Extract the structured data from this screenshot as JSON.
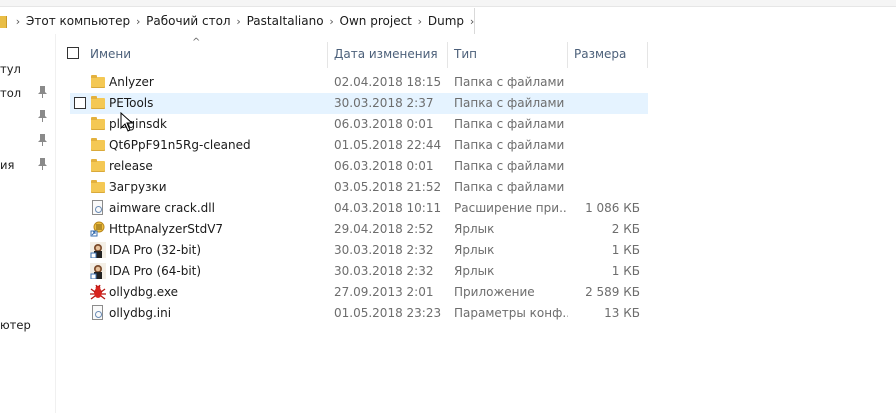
{
  "breadcrumb": {
    "items": [
      "Этот компьютер",
      "Рабочий стол",
      "PastaItaliano",
      "Own project",
      "Dump"
    ]
  },
  "nav": {
    "labels": [
      "тул",
      "тол",
      "ия",
      "ютер"
    ]
  },
  "columns": {
    "name": "Имени",
    "date": "Дата изменения",
    "type": "Тип",
    "size": "Размера"
  },
  "files": [
    {
      "name": "Anlyzer",
      "date": "02.04.2018 18:15",
      "type": "Папка с файлами",
      "size": "",
      "icon": "folder-icon"
    },
    {
      "name": "PETools",
      "date": "30.03.2018 2:37",
      "type": "Папка с файлами",
      "size": "",
      "icon": "folder-icon"
    },
    {
      "name": "pluginsdk",
      "date": "06.03.2018 0:01",
      "type": "Папка с файлами",
      "size": "",
      "icon": "folder-icon"
    },
    {
      "name": "Qt6PpF91n5Rg-cleaned",
      "date": "01.05.2018 22:44",
      "type": "Папка с файлами",
      "size": "",
      "icon": "folder-icon"
    },
    {
      "name": "release",
      "date": "06.03.2018 0:01",
      "type": "Папка с файлами",
      "size": "",
      "icon": "folder-icon"
    },
    {
      "name": "Загрузки",
      "date": "03.05.2018 21:52",
      "type": "Папка с файлами",
      "size": "",
      "icon": "folder-icon"
    },
    {
      "name": "aimware crack.dll",
      "date": "04.03.2018 10:11",
      "type": "Расширение при...",
      "size": "1 086 КБ",
      "icon": "dll-file-icon"
    },
    {
      "name": "HttpAnalyzerStdV7",
      "date": "29.04.2018 2:52",
      "type": "Ярлык",
      "size": "2 КБ",
      "icon": "http-analyzer-shortcut-icon"
    },
    {
      "name": "IDA Pro (32-bit)",
      "date": "30.03.2018 2:32",
      "type": "Ярлык",
      "size": "1 КБ",
      "icon": "ida-pro-icon"
    },
    {
      "name": "IDA Pro (64-bit)",
      "date": "30.03.2018 2:32",
      "type": "Ярлык",
      "size": "1 КБ",
      "icon": "ida-pro-icon"
    },
    {
      "name": "ollydbg.exe",
      "date": "27.09.2013 2:01",
      "type": "Приложение",
      "size": "2 589 КБ",
      "icon": "ollydbg-bug-icon"
    },
    {
      "name": "ollydbg.ini",
      "date": "01.05.2018 23:23",
      "type": "Параметры конф...",
      "size": "13 КБ",
      "icon": "ini-file-icon"
    }
  ]
}
